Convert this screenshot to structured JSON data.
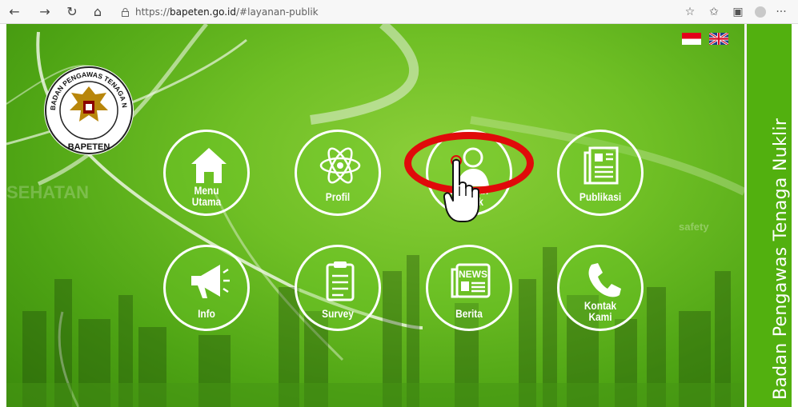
{
  "browser": {
    "url_prefix": "https://",
    "url_host": "bapeten.go.id",
    "url_path": "/#layanan-publik",
    "back_glyph": "←",
    "forward_glyph": "→",
    "refresh_glyph": "↻",
    "home_glyph": "⌂",
    "fav_glyph": "☆",
    "favorites_glyph": "✩",
    "collections_glyph": "▣",
    "more_glyph": "···"
  },
  "site": {
    "sidebar_title": "Badan Pengawas Tenaga Nuklir",
    "logo": {
      "ring_text": "BADAN PENGAWAS TENAGA NUKLIR",
      "name": "BAPETEN"
    },
    "menu": [
      {
        "id": "menu-utama",
        "icon": "home-icon",
        "label_lines": [
          "Menu",
          "Utama"
        ]
      },
      {
        "id": "profil",
        "icon": "atom-icon",
        "label_lines": [
          "Profil"
        ]
      },
      {
        "id": "layanan-publik",
        "icon": "person-headset-icon",
        "label_lines": [
          "Layanan",
          "Publik"
        ]
      },
      {
        "id": "publikasi",
        "icon": "newspaper-icon",
        "label_lines": [
          "Publikasi"
        ]
      },
      {
        "id": "info",
        "icon": "megaphone-icon",
        "label_lines": [
          "Info"
        ]
      },
      {
        "id": "survey",
        "icon": "clipboard-icon",
        "label_lines": [
          "Survey"
        ]
      },
      {
        "id": "berita",
        "icon": "news-icon",
        "label_lines": [
          "Berita"
        ]
      },
      {
        "id": "kontak-kami",
        "icon": "phone-icon",
        "label_lines": [
          "Kontak",
          "Kami"
        ]
      }
    ],
    "news_icon_text": "NEWS",
    "background_words": [
      "SEHATAN",
      "safety"
    ]
  },
  "colors": {
    "sidebar_green": "#52b00f",
    "highlight_red": "#e00a0a",
    "button_border": "#ffffff"
  }
}
